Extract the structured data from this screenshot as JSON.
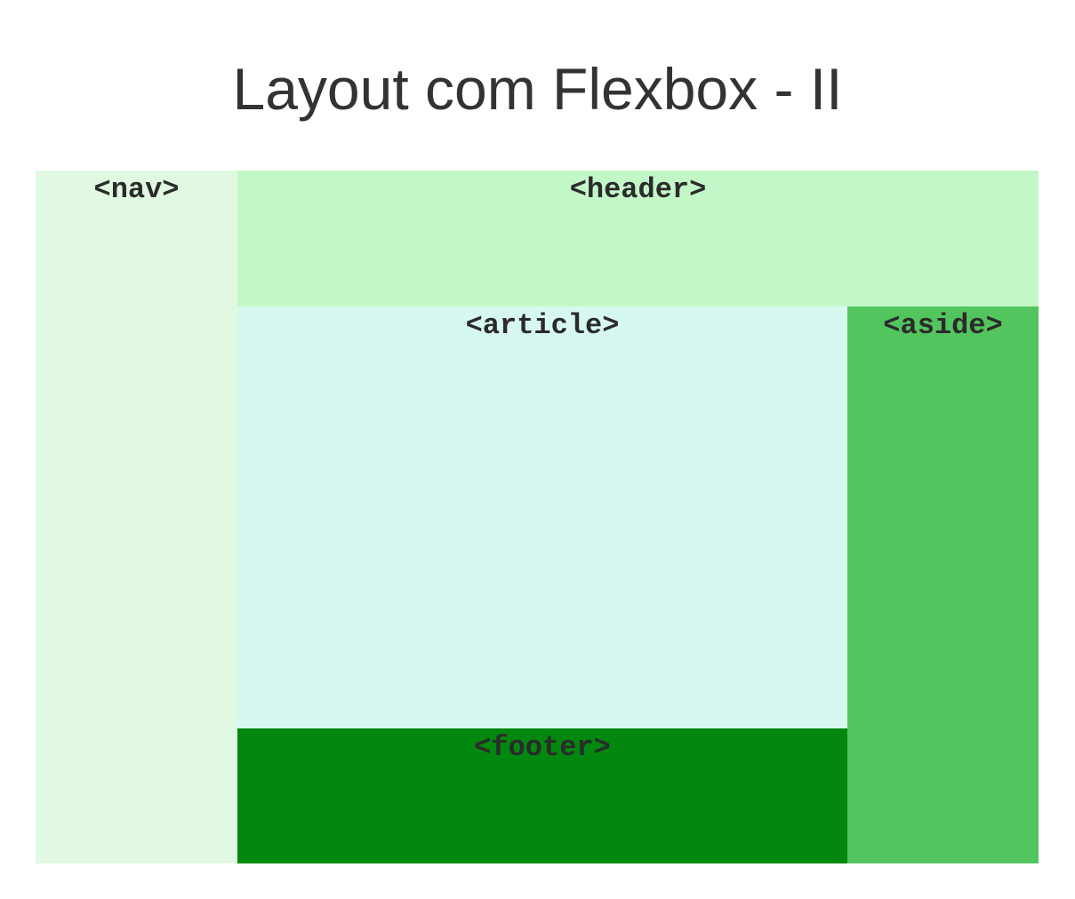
{
  "page": {
    "title": "Layout com Flexbox - II"
  },
  "nav": {
    "label": "<nav>"
  },
  "header": {
    "label": "<header>"
  },
  "article": {
    "label": "<article>"
  },
  "aside": {
    "label": "<aside>"
  },
  "footer": {
    "label": "<footer>"
  },
  "colors": {
    "nav": "#e1f9e2",
    "header": "#c3f7c8",
    "article": "#d7f8f0",
    "aside": "#53c55e",
    "footer": "#02880f",
    "text": "#333333"
  }
}
